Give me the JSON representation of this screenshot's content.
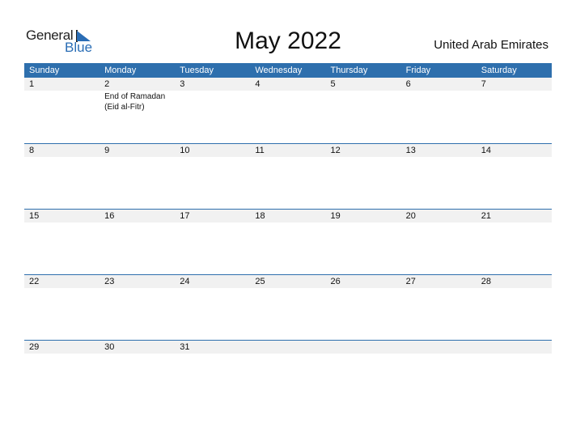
{
  "logo": {
    "line1": "General",
    "line2": "Blue"
  },
  "title": "May 2022",
  "country": "United Arab Emirates",
  "colors": {
    "accent": "#2e6fad",
    "strip": "#f1f1f1"
  },
  "weekdays": [
    "Sunday",
    "Monday",
    "Tuesday",
    "Wednesday",
    "Thursday",
    "Friday",
    "Saturday"
  ],
  "weeks": [
    {
      "days": [
        "1",
        "2",
        "3",
        "4",
        "5",
        "6",
        "7"
      ],
      "events": [
        "",
        "End of Ramadan (Eid al-Fitr)",
        "",
        "",
        "",
        "",
        ""
      ]
    },
    {
      "days": [
        "8",
        "9",
        "10",
        "11",
        "12",
        "13",
        "14"
      ],
      "events": [
        "",
        "",
        "",
        "",
        "",
        "",
        ""
      ]
    },
    {
      "days": [
        "15",
        "16",
        "17",
        "18",
        "19",
        "20",
        "21"
      ],
      "events": [
        "",
        "",
        "",
        "",
        "",
        "",
        ""
      ]
    },
    {
      "days": [
        "22",
        "23",
        "24",
        "25",
        "26",
        "27",
        "28"
      ],
      "events": [
        "",
        "",
        "",
        "",
        "",
        "",
        ""
      ]
    },
    {
      "days": [
        "29",
        "30",
        "31",
        "",
        "",
        "",
        ""
      ],
      "events": [
        "",
        "",
        "",
        "",
        "",
        "",
        ""
      ]
    }
  ]
}
